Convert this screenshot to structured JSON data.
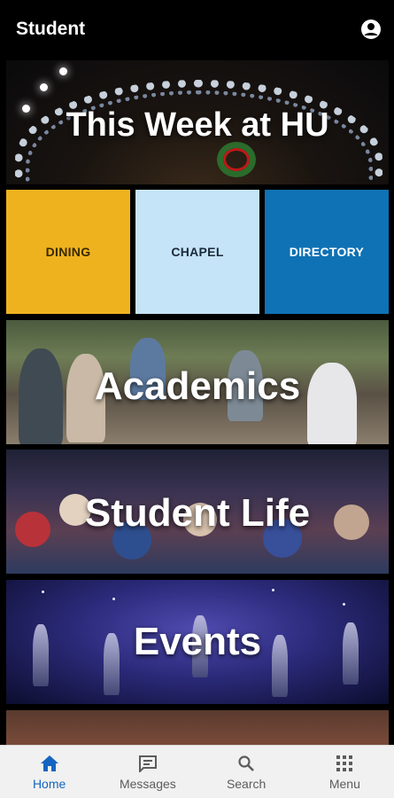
{
  "header": {
    "title": "Student",
    "account_icon": "account-circle-icon"
  },
  "banners": {
    "this_week": "This Week at HU",
    "academics": "Academics",
    "student_life": "Student Life",
    "events": "Events"
  },
  "quick_tiles": {
    "dining": {
      "label": "DINING",
      "color": "#efb21f"
    },
    "chapel": {
      "label": "CHAPEL",
      "color": "#c6e4f7"
    },
    "directory": {
      "label": "DIRECTORY",
      "color": "#0f72b4"
    }
  },
  "bottom_nav": {
    "active": "home",
    "home": {
      "label": "Home",
      "icon": "home-icon"
    },
    "messages": {
      "label": "Messages",
      "icon": "message-icon"
    },
    "search": {
      "label": "Search",
      "icon": "search-icon"
    },
    "menu": {
      "label": "Menu",
      "icon": "grid-menu-icon"
    }
  },
  "colors": {
    "accent": "#1565c0",
    "background": "#000000"
  }
}
